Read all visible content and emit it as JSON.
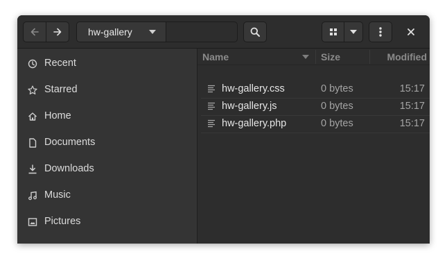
{
  "header": {
    "path_segment": "hw-gallery"
  },
  "sidebar": {
    "items": [
      {
        "label": "Recent",
        "icon": "clock-icon"
      },
      {
        "label": "Starred",
        "icon": "star-icon"
      },
      {
        "label": "Home",
        "icon": "home-icon"
      },
      {
        "label": "Documents",
        "icon": "document-icon"
      },
      {
        "label": "Downloads",
        "icon": "download-icon"
      },
      {
        "label": "Music",
        "icon": "music-icon"
      },
      {
        "label": "Pictures",
        "icon": "picture-icon"
      }
    ]
  },
  "file_list": {
    "columns": {
      "name": "Name",
      "size": "Size",
      "modified": "Modified"
    },
    "rows": [
      {
        "name": "hw-gallery.css",
        "size": "0 bytes",
        "modified": "15:17"
      },
      {
        "name": "hw-gallery.js",
        "size": "0 bytes",
        "modified": "15:17"
      },
      {
        "name": "hw-gallery.php",
        "size": "0 bytes",
        "modified": "15:17"
      }
    ]
  },
  "colors": {
    "window_bg": "#353535",
    "headerbar_bg": "#2d2d2d",
    "text": "#e6e6e6",
    "dim_text": "#a4a4a4"
  }
}
